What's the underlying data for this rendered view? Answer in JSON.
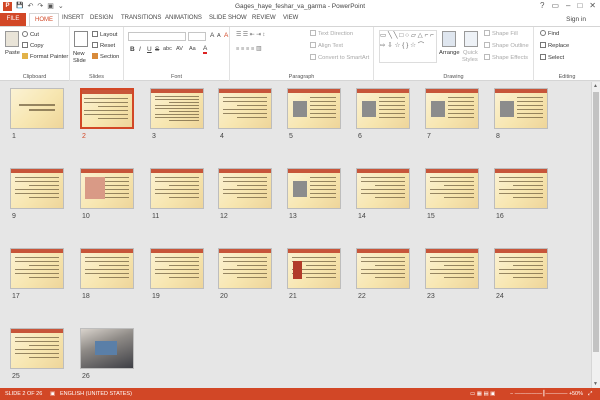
{
  "window": {
    "title": "Gages_haye_feshar_va_garma - PowerPoint",
    "app_icon": "P",
    "minimize": "–",
    "maximize": "□",
    "close": "✕",
    "help": "?",
    "restore": "▭"
  },
  "quick_access": {
    "save": "💾",
    "undo": "↶",
    "redo": "↷",
    "present": "▣",
    "customize": "⌄"
  },
  "tabs": {
    "file": "FILE",
    "items": [
      "HOME",
      "INSERT",
      "DESIGN",
      "TRANSITIONS",
      "ANIMATIONS",
      "SLIDE SHOW",
      "REVIEW",
      "VIEW"
    ],
    "active": "HOME",
    "sign_in": "Sign in"
  },
  "ribbon": {
    "clipboard": {
      "name": "Clipboard",
      "paste": "Paste",
      "cut": "Cut",
      "copy": "Copy",
      "format_painter": "Format Painter"
    },
    "slides": {
      "name": "Slides",
      "new_slide_1": "New",
      "new_slide_2": "Slide",
      "layout": "Layout",
      "reset": "Reset",
      "section": "Section"
    },
    "font": {
      "name": "Font",
      "bold": "B",
      "italic": "I",
      "underline": "U",
      "strike": "S",
      "abc": "abc",
      "av": "AV",
      "aa": "Aa",
      "grow": "A",
      "shrink": "A",
      "clear": "A",
      "font_color": "A"
    },
    "paragraph": {
      "name": "Paragraph",
      "text_direction": "Text Direction",
      "align_text": "Align Text",
      "convert_smartart": "Convert to SmartArt"
    },
    "drawing": {
      "name": "Drawing",
      "arrange": "Arrange",
      "quick_styles_1": "Quick",
      "quick_styles_2": "Styles",
      "shape_fill": "Shape Fill",
      "shape_outline": "Shape Outline",
      "shape_effects": "Shape Effects"
    },
    "editing": {
      "name": "Editing",
      "find": "Find",
      "replace": "Replace",
      "select": "Select"
    }
  },
  "slides": [
    {
      "n": "1"
    },
    {
      "n": "2"
    },
    {
      "n": "3"
    },
    {
      "n": "4"
    },
    {
      "n": "5"
    },
    {
      "n": "6"
    },
    {
      "n": "7"
    },
    {
      "n": "8"
    },
    {
      "n": "9"
    },
    {
      "n": "10"
    },
    {
      "n": "11"
    },
    {
      "n": "12"
    },
    {
      "n": "13"
    },
    {
      "n": "14"
    },
    {
      "n": "15"
    },
    {
      "n": "16"
    },
    {
      "n": "17"
    },
    {
      "n": "18"
    },
    {
      "n": "19"
    },
    {
      "n": "20"
    },
    {
      "n": "21"
    },
    {
      "n": "22"
    },
    {
      "n": "23"
    },
    {
      "n": "24"
    },
    {
      "n": "25"
    },
    {
      "n": "26"
    }
  ],
  "selected_slide": 2,
  "status": {
    "slide_info": "SLIDE 2 OF 26",
    "language": "ENGLISH (UNITED STATES)",
    "zoom": "50%"
  },
  "colors": {
    "accent": "#d24726",
    "slide_bg": "#f7e6b0",
    "title_bar": "#c7553a"
  }
}
